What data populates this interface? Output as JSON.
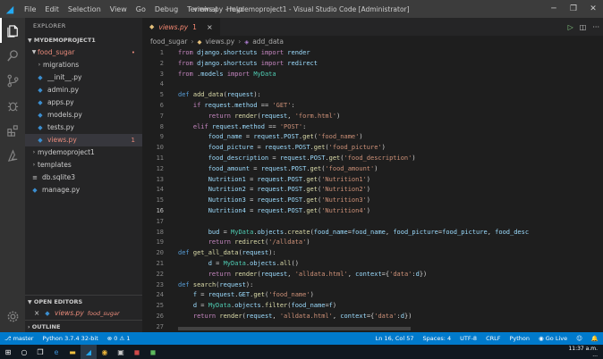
{
  "titlebar": {
    "menu": [
      "File",
      "Edit",
      "Selection",
      "View",
      "Go",
      "Debug",
      "Terminal",
      "Help"
    ],
    "window_title": "views.py - mydemoproject1 - Visual Studio Code [Administrator]"
  },
  "sidebar": {
    "title": "EXPLORER",
    "project": "MYDEMOPROJECT1",
    "items": [
      {
        "label": "food_sugar",
        "badge": "•",
        "kind": "folder-open",
        "depth": 0,
        "color": "#e88a7a"
      },
      {
        "label": "migrations",
        "kind": "folder",
        "depth": 1,
        "color": "#cccccc"
      },
      {
        "label": "__init__.py",
        "kind": "py",
        "depth": 1,
        "color": "#cccccc"
      },
      {
        "label": "admin.py",
        "kind": "py",
        "depth": 1,
        "color": "#cccccc"
      },
      {
        "label": "apps.py",
        "kind": "py",
        "depth": 1,
        "color": "#cccccc"
      },
      {
        "label": "models.py",
        "kind": "py",
        "depth": 1,
        "color": "#cccccc"
      },
      {
        "label": "tests.py",
        "kind": "py",
        "depth": 1,
        "color": "#cccccc"
      },
      {
        "label": "views.py",
        "badge": "1",
        "kind": "py",
        "depth": 1,
        "color": "#e88a7a"
      },
      {
        "label": "mydemoproject1",
        "kind": "folder",
        "depth": 0,
        "color": "#cccccc"
      },
      {
        "label": "templates",
        "kind": "folder",
        "depth": 0,
        "color": "#cccccc"
      },
      {
        "label": "db.sqlite3",
        "kind": "db",
        "depth": 0,
        "color": "#cccccc"
      },
      {
        "label": "manage.py",
        "kind": "py",
        "depth": 0,
        "color": "#cccccc"
      }
    ],
    "open_editors_title": "OPEN EDITORS",
    "open_editor": {
      "close": "×",
      "name": "views.py",
      "path": "food_sugar"
    },
    "outline_title": "OUTLINE"
  },
  "editor": {
    "tab": {
      "name": "views.py",
      "badge": "1"
    },
    "breadcrumb": [
      "food_sugar",
      "views.py",
      "add_data"
    ]
  },
  "code_lines": [
    {
      "n": "1",
      "t": "from django.shortcuts import render"
    },
    {
      "n": "2",
      "t": "from django.shortcuts import redirect"
    },
    {
      "n": "3",
      "t": "from .models import MyData"
    },
    {
      "n": "4",
      "t": ""
    },
    {
      "n": "5",
      "t": "def add_data(request):"
    },
    {
      "n": "6",
      "t": "    if request.method == 'GET':"
    },
    {
      "n": "7",
      "t": "        return render(request, 'form.html')"
    },
    {
      "n": "8",
      "t": "    elif request.method == 'POST':"
    },
    {
      "n": "9",
      "t": "        food_name = request.POST.get('food_name')"
    },
    {
      "n": "10",
      "t": "        food_picture = request.POST.get('food_picture')"
    },
    {
      "n": "11",
      "t": "        food_description = request.POST.get('food_description')"
    },
    {
      "n": "12",
      "t": "        food_amount = request.POST.get('food_amount')"
    },
    {
      "n": "13",
      "t": "        Nutrition1 = request.POST.get('Nutrition1')"
    },
    {
      "n": "14",
      "t": "        Nutrition2 = request.POST.get('Nutrition2')"
    },
    {
      "n": "15",
      "t": "        Nutrition3 = request.POST.get('Nutrition3')"
    },
    {
      "n": "16",
      "t": "        Nutrition4 = request.POST.get('Nutrition4')"
    },
    {
      "n": "17",
      "t": ""
    },
    {
      "n": "18",
      "t": "        bud = MyData.objects.create(food_name=food_name, food_picture=food_picture, food_desc"
    },
    {
      "n": "19",
      "t": "        return redirect('/alldata')"
    },
    {
      "n": "20",
      "t": "def get_all_data(request):"
    },
    {
      "n": "21",
      "t": "        d = MyData.objects.all()"
    },
    {
      "n": "22",
      "t": "        return render(request, 'alldata.html', context={'data':d})"
    },
    {
      "n": "23",
      "t": "def search(request):"
    },
    {
      "n": "24",
      "t": "    f = request.GET.get('food_name')"
    },
    {
      "n": "25",
      "t": "    d = MyData.objects.filter(food_name=f)"
    },
    {
      "n": "26",
      "t": "    return render(request, 'alldata.html', context={'data':d})"
    },
    {
      "n": "27",
      "t": ""
    }
  ],
  "statusbar": {
    "remote": "master",
    "python": "Python 3.7.4 32-bit",
    "problems": "⊗ 0 ⚠ 1",
    "position": "Ln 16, Col 57",
    "spaces": "Spaces: 4",
    "encoding": "UTF-8",
    "eol": "CRLF",
    "language": "Python",
    "golive": "Go Live"
  },
  "taskbar": {
    "time": "11:37 a.m.",
    "date": "..."
  },
  "colors": {
    "accent": "#007acc",
    "error": "#f48771"
  }
}
